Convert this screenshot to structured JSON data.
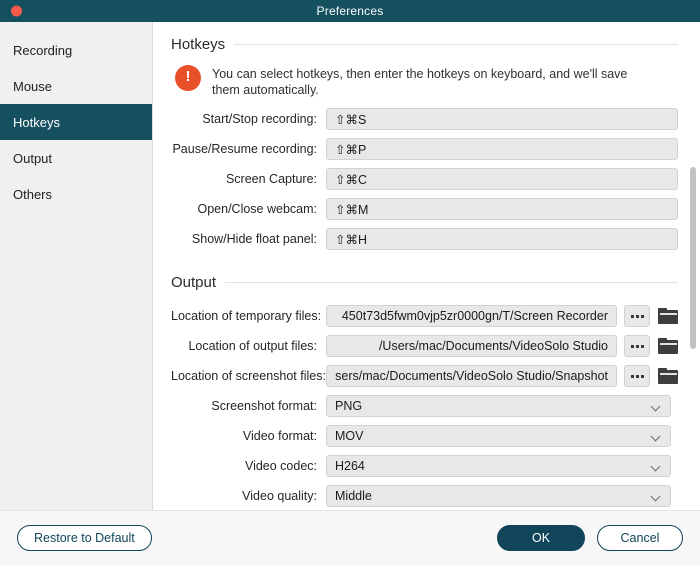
{
  "window": {
    "title": "Preferences",
    "close_icon": "close-dot-icon",
    "accent_teal": "#15505f",
    "accent_primary": "#10455a",
    "notice_orange": "#e8502a",
    "close_red": "#f45b4a"
  },
  "sidebar": {
    "items": [
      {
        "label": "Recording",
        "active": false
      },
      {
        "label": "Mouse",
        "active": false
      },
      {
        "label": "Hotkeys",
        "active": true
      },
      {
        "label": "Output",
        "active": false
      },
      {
        "label": "Others",
        "active": false
      }
    ]
  },
  "hotkeys_section": {
    "title": "Hotkeys",
    "notice_icon": "exclamation-circle-icon",
    "notice": "You can select hotkeys, then enter the hotkeys on keyboard, and we'll save them automatically.",
    "rows": [
      {
        "label": "Start/Stop recording:",
        "value": "⇧⌘S"
      },
      {
        "label": "Pause/Resume recording:",
        "value": "⇧⌘P"
      },
      {
        "label": "Screen Capture:",
        "value": "⇧⌘C"
      },
      {
        "label": "Open/Close webcam:",
        "value": "⇧⌘M"
      },
      {
        "label": "Show/Hide float panel:",
        "value": "⇧⌘H"
      }
    ]
  },
  "output_section": {
    "title": "Output",
    "paths": [
      {
        "label": "Location of temporary files:",
        "value": "450t73d5fwm0vjp5zr0000gn/T/Screen Recorder",
        "browse_icon": "ellipsis-icon",
        "folder_icon": "folder-icon"
      },
      {
        "label": "Location of output files:",
        "value": "/Users/mac/Documents/VideoSolo Studio",
        "browse_icon": "ellipsis-icon",
        "folder_icon": "folder-icon"
      },
      {
        "label": "Location of screenshot files:",
        "value": "sers/mac/Documents/VideoSolo Studio/Snapshot",
        "browse_icon": "ellipsis-icon",
        "folder_icon": "folder-icon"
      }
    ],
    "selects": [
      {
        "label": "Screenshot format:",
        "value": "PNG",
        "chevron_icon": "chevron-down-icon"
      },
      {
        "label": "Video format:",
        "value": "MOV",
        "chevron_icon": "chevron-down-icon"
      },
      {
        "label": "Video codec:",
        "value": "H264",
        "chevron_icon": "chevron-down-icon"
      },
      {
        "label": "Video quality:",
        "value": "Middle",
        "chevron_icon": "chevron-down-icon"
      }
    ]
  },
  "footer": {
    "restore_label": "Restore to Default",
    "ok_label": "OK",
    "cancel_label": "Cancel"
  }
}
